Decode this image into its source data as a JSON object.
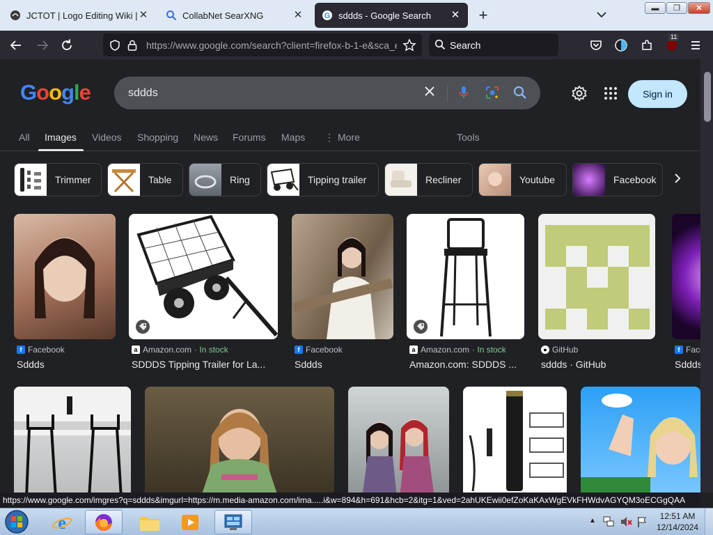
{
  "browser": {
    "tabs": [
      {
        "title": "JCTOT | Logo Editing Wiki | Fan",
        "active": false
      },
      {
        "title": "CollabNet SearXNG",
        "active": false
      },
      {
        "title": "sddds - Google Search",
        "active": true
      }
    ],
    "url_host": "https://www.google.com",
    "url_path": "/search?client=firefox-b-1-e&sca_e",
    "search_placeholder": "Search",
    "extension_badge": "11"
  },
  "google": {
    "logo_letters": [
      "G",
      "o",
      "o",
      "g",
      "l",
      "e"
    ],
    "logo_colors": [
      "#4285f4",
      "#ea4335",
      "#fbbc05",
      "#4285f4",
      "#34a853",
      "#ea4335"
    ],
    "query": "sddds",
    "sign_in_label": "Sign in",
    "nav_tabs": [
      "All",
      "Images",
      "Videos",
      "Shopping",
      "News",
      "Forums",
      "Maps",
      "More"
    ],
    "active_tab": "Images",
    "tools_label": "Tools",
    "chips": [
      "Trimmer",
      "Table",
      "Ring",
      "Tipping trailer",
      "Recliner",
      "Youtube",
      "Facebook"
    ],
    "row1": [
      {
        "source": "Facebook",
        "caption": "Sddds",
        "stock": ""
      },
      {
        "source": "Amazon.com",
        "caption": "SDDDS Tipping Trailer for La...",
        "stock": "· In stock"
      },
      {
        "source": "Facebook",
        "caption": "Sddds",
        "stock": ""
      },
      {
        "source": "Amazon.com",
        "caption": "Amazon.com: SDDDS ...",
        "stock": "· In stock"
      },
      {
        "source": "GitHub",
        "caption": "sddds · GitHub",
        "stock": ""
      },
      {
        "source": "Face",
        "caption": "Sddds",
        "stock": ""
      }
    ]
  },
  "status_url": "https://www.google.com/imgres?q=sddds&imgurl=https://m.media-amazon.com/ima.....i&w=894&h=691&hcb=2&itg=1&ved=2ahUKEwii0efZoKaKAxWgEVkFHWdvAGYQM3oECGgQAA",
  "taskbar": {
    "time": "12:51 AM",
    "date": "12/14/2024"
  }
}
